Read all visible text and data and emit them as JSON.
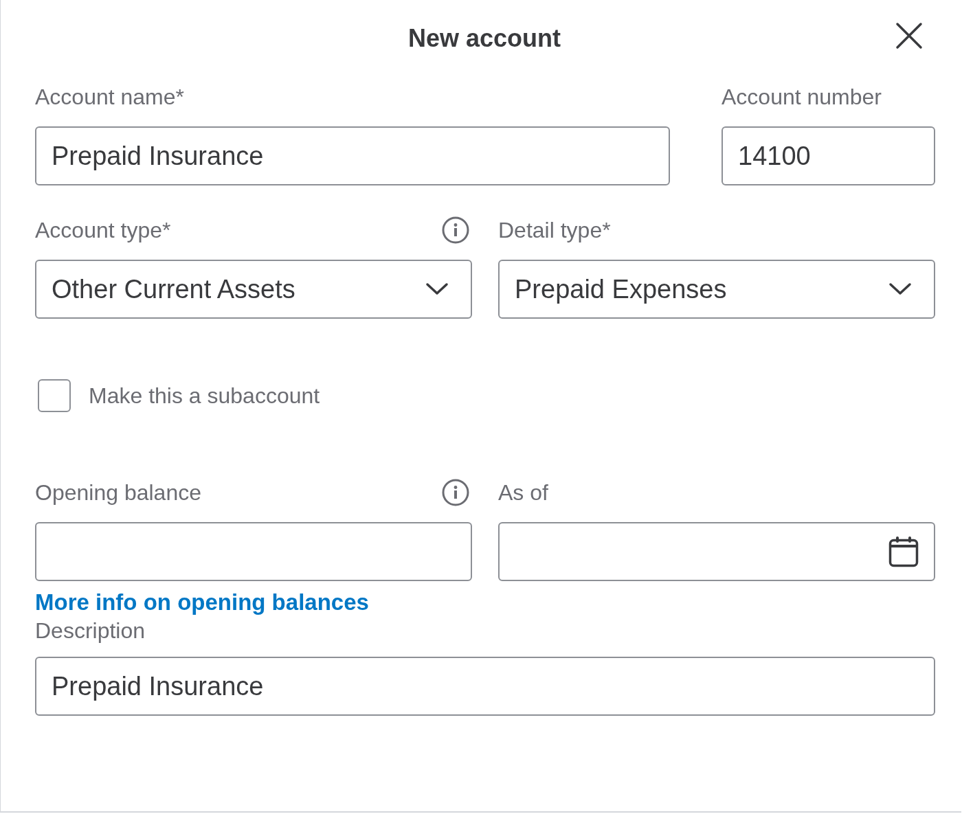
{
  "dialog": {
    "title": "New account"
  },
  "account_name": {
    "label": "Account name*",
    "value": "Prepaid Insurance"
  },
  "account_number": {
    "label": "Account number",
    "value": "14100"
  },
  "account_type": {
    "label": "Account type*",
    "value": "Other Current Assets"
  },
  "detail_type": {
    "label": "Detail type*",
    "value": "Prepaid Expenses"
  },
  "subaccount": {
    "label": "Make this a subaccount",
    "checked": false
  },
  "opening_balance": {
    "label": "Opening balance"
  },
  "as_of": {
    "label": "As of"
  },
  "opening_balance_link": "More info on opening balances",
  "description": {
    "label": "Description",
    "value": "Prepaid Insurance"
  }
}
